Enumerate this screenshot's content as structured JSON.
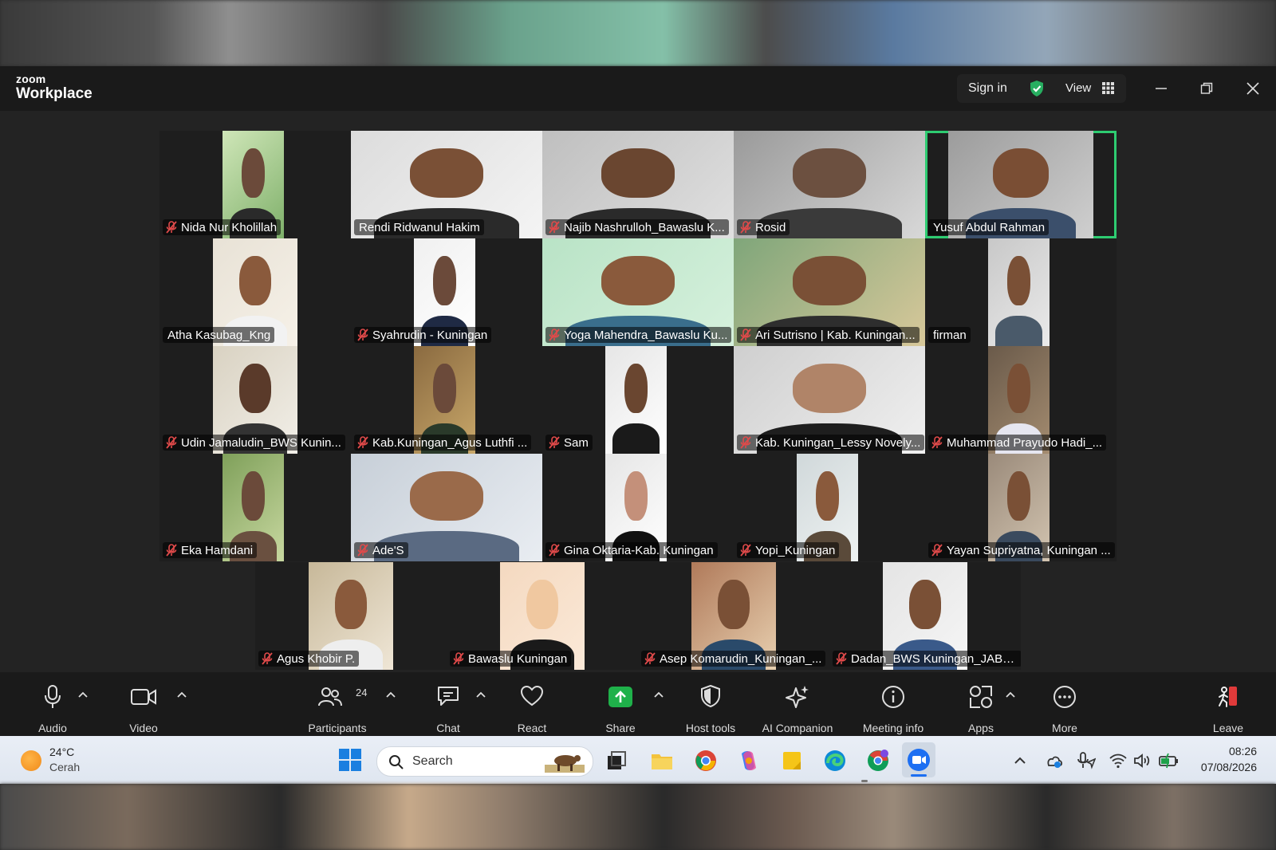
{
  "window": {
    "brand_small": "zoom",
    "brand_big": "Workplace",
    "sign_in": "Sign in",
    "view": "View",
    "accent_green": "#2ecc71"
  },
  "participants": [
    {
      "name": "Nida Nur Kholillah",
      "muted": true,
      "active": false
    },
    {
      "name": "Rendi Ridwanul Hakim",
      "muted": false,
      "active": false
    },
    {
      "name": "Najib Nashrulloh_Bawaslu K...",
      "muted": true,
      "active": false
    },
    {
      "name": "Rosid",
      "muted": true,
      "active": false
    },
    {
      "name": "Yusuf Abdul Rahman",
      "muted": false,
      "active": true
    },
    {
      "name": "Atha Kasubag_Kng",
      "muted": false,
      "active": false
    },
    {
      "name": "Syahrudin - Kuningan",
      "muted": true,
      "active": false
    },
    {
      "name": "Yoga Mahendra_Bawaslu Ku...",
      "muted": true,
      "active": false
    },
    {
      "name": "Ari Sutrisno | Kab. Kuningan...",
      "muted": true,
      "active": false
    },
    {
      "name": "firman",
      "muted": false,
      "active": false
    },
    {
      "name": "Udin Jamaludin_BWS Kunin...",
      "muted": true,
      "active": false
    },
    {
      "name": "Kab.Kuningan_Agus Luthfi ...",
      "muted": true,
      "active": false
    },
    {
      "name": "Sam",
      "muted": true,
      "active": false
    },
    {
      "name": "Kab. Kuningan_Lessy Novely...",
      "muted": true,
      "active": false
    },
    {
      "name": "Muhammad Prayudo Hadi_...",
      "muted": true,
      "active": false
    },
    {
      "name": "Eka Hamdani",
      "muted": true,
      "active": false
    },
    {
      "name": "Ade'S",
      "muted": true,
      "active": false
    },
    {
      "name": "Gina Oktaria-Kab. Kuningan",
      "muted": true,
      "active": false
    },
    {
      "name": "Yopi_Kuningan",
      "muted": true,
      "active": false
    },
    {
      "name": "Yayan Supriyatna, Kuningan ...",
      "muted": true,
      "active": false
    },
    {
      "name": "Agus Khobir P.",
      "muted": true,
      "active": false
    },
    {
      "name": "Bawaslu Kuningan",
      "muted": true,
      "active": false
    },
    {
      "name": "Asep Komarudin_Kuningan_...",
      "muted": true,
      "active": false
    },
    {
      "name": "Dadan_BWS Kuningan_JABAR",
      "muted": true,
      "active": false
    }
  ],
  "toolbar": {
    "audio": "Audio",
    "video": "Video",
    "participants": "Participants",
    "participant_count": "24",
    "chat": "Chat",
    "react": "React",
    "share": "Share",
    "host_tools": "Host tools",
    "ai_companion": "AI Companion",
    "meeting_info": "Meeting info",
    "apps": "Apps",
    "more": "More",
    "leave": "Leave"
  },
  "taskbar": {
    "temperature": "24°C",
    "condition": "Cerah",
    "search_placeholder": "Search",
    "time": "08:26",
    "date": "07/08/2026"
  }
}
